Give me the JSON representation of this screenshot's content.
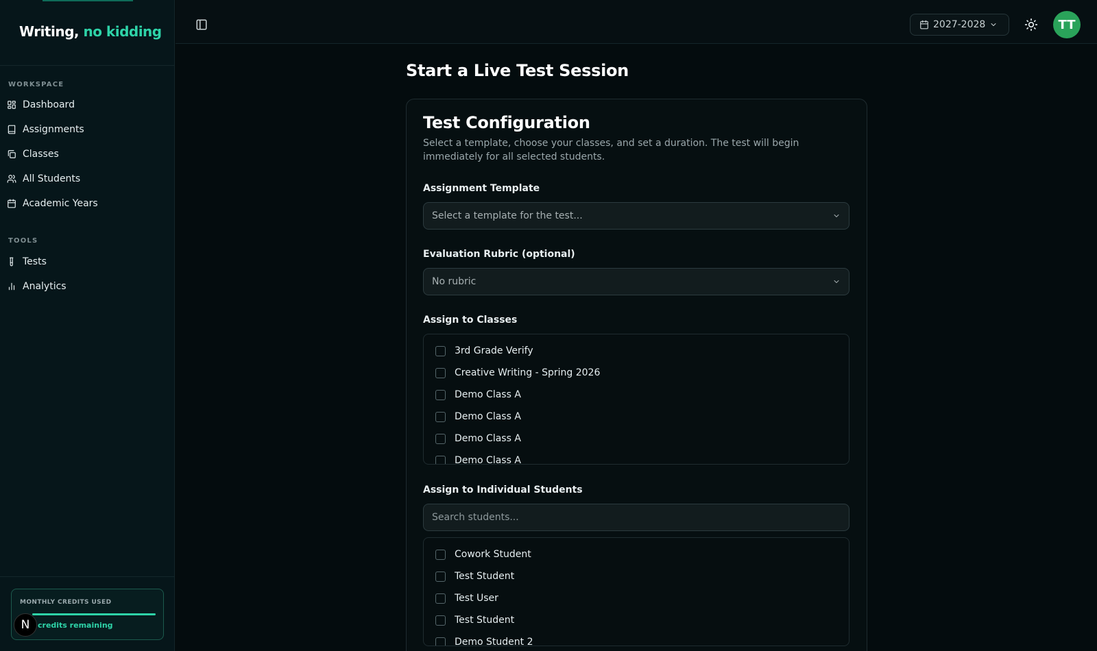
{
  "brand": {
    "part1": "Writing,",
    "part2": "no kidding"
  },
  "sidebar": {
    "workspace_label": "WORKSPACE",
    "workspace_items": [
      {
        "label": "Dashboard",
        "icon": "dashboard-icon"
      },
      {
        "label": "Assignments",
        "icon": "book-icon"
      },
      {
        "label": "Classes",
        "icon": "copy-icon"
      },
      {
        "label": "All Students",
        "icon": "users-icon"
      },
      {
        "label": "Academic Years",
        "icon": "calendar-icon"
      }
    ],
    "tools_label": "TOOLS",
    "tools_items": [
      {
        "label": "Tests",
        "icon": "test-tube-icon"
      },
      {
        "label": "Analytics",
        "icon": "bar-chart-icon"
      }
    ],
    "credits": {
      "title": "MONTHLY CREDITS USED",
      "remaining_text": "credits remaining",
      "progress": 1.0
    },
    "badge_letter": "N"
  },
  "topbar": {
    "year": "2027-2028",
    "avatar_initials": "TT"
  },
  "main": {
    "page_title": "Start a Live Test Session",
    "card": {
      "title": "Test Configuration",
      "description": "Select a template, choose your classes, and set a duration. The test will begin immediately for all selected students.",
      "template_label": "Assignment Template",
      "template_placeholder": "Select a template for the test...",
      "rubric_label": "Evaluation Rubric (optional)",
      "rubric_value": "No rubric",
      "classes_label": "Assign to Classes",
      "classes": [
        "3rd Grade Verify",
        "Creative Writing - Spring 2026",
        "Demo Class A",
        "Demo Class A",
        "Demo Class A",
        "Demo Class A"
      ],
      "students_label": "Assign to Individual Students",
      "students_search_placeholder": "Search students...",
      "students": [
        "Cowork Student",
        "Test Student",
        "Test User",
        "Test Student",
        "Demo Student 2"
      ]
    }
  },
  "colors": {
    "accent": "#2ed3a8",
    "avatar": "#2aa35a",
    "background": "#040c0e",
    "sidebar": "#06161a"
  }
}
